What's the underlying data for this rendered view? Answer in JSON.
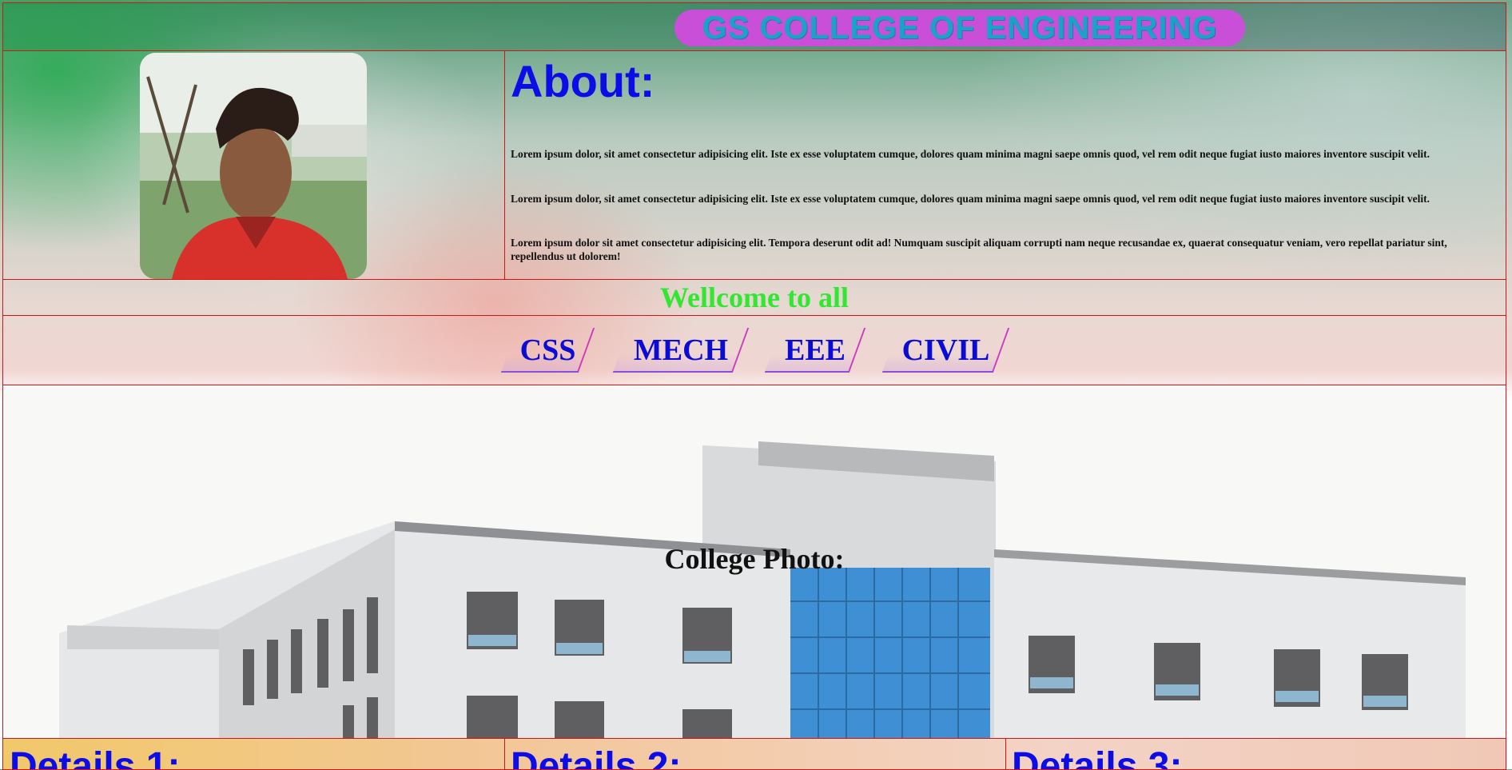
{
  "header": {
    "college_name": "GS COLLEGE OF ENGINEERING"
  },
  "about": {
    "heading": "About:",
    "paragraphs": [
      "Lorem ipsum dolor, sit amet consectetur adipisicing elit. Iste ex esse voluptatem cumque, dolores quam minima magni saepe omnis quod, vel rem odit neque fugiat iusto maiores inventore suscipit velit.",
      "Lorem ipsum dolor, sit amet consectetur adipisicing elit. Iste ex esse voluptatem cumque, dolores quam minima magni saepe omnis quod, vel rem odit neque fugiat iusto maiores inventore suscipit velit.",
      "Lorem ipsum dolor sit amet consectetur adipisicing elit. Tempora deserunt odit ad! Numquam suscipit aliquam corrupti nam neque recusandae ex, quaerat consequatur veniam, vero repellat pariatur sint, repellendus ut dolorem!"
    ]
  },
  "welcome": "Wellcome to all",
  "nav": [
    {
      "label": "CSS"
    },
    {
      "label": "MECH"
    },
    {
      "label": "EEE"
    },
    {
      "label": "CIVIL"
    }
  ],
  "college_photo": {
    "caption": "College Photo:"
  },
  "details": [
    {
      "title": "Details 1:"
    },
    {
      "title": "Details 2:"
    },
    {
      "title": "Details 3:"
    }
  ],
  "colors": {
    "border": "#d41515",
    "title_pill": "#c94fd8",
    "title_text": "#1aa2c9",
    "heading_blue": "#0c0ce6",
    "welcome_green": "#32e632"
  }
}
